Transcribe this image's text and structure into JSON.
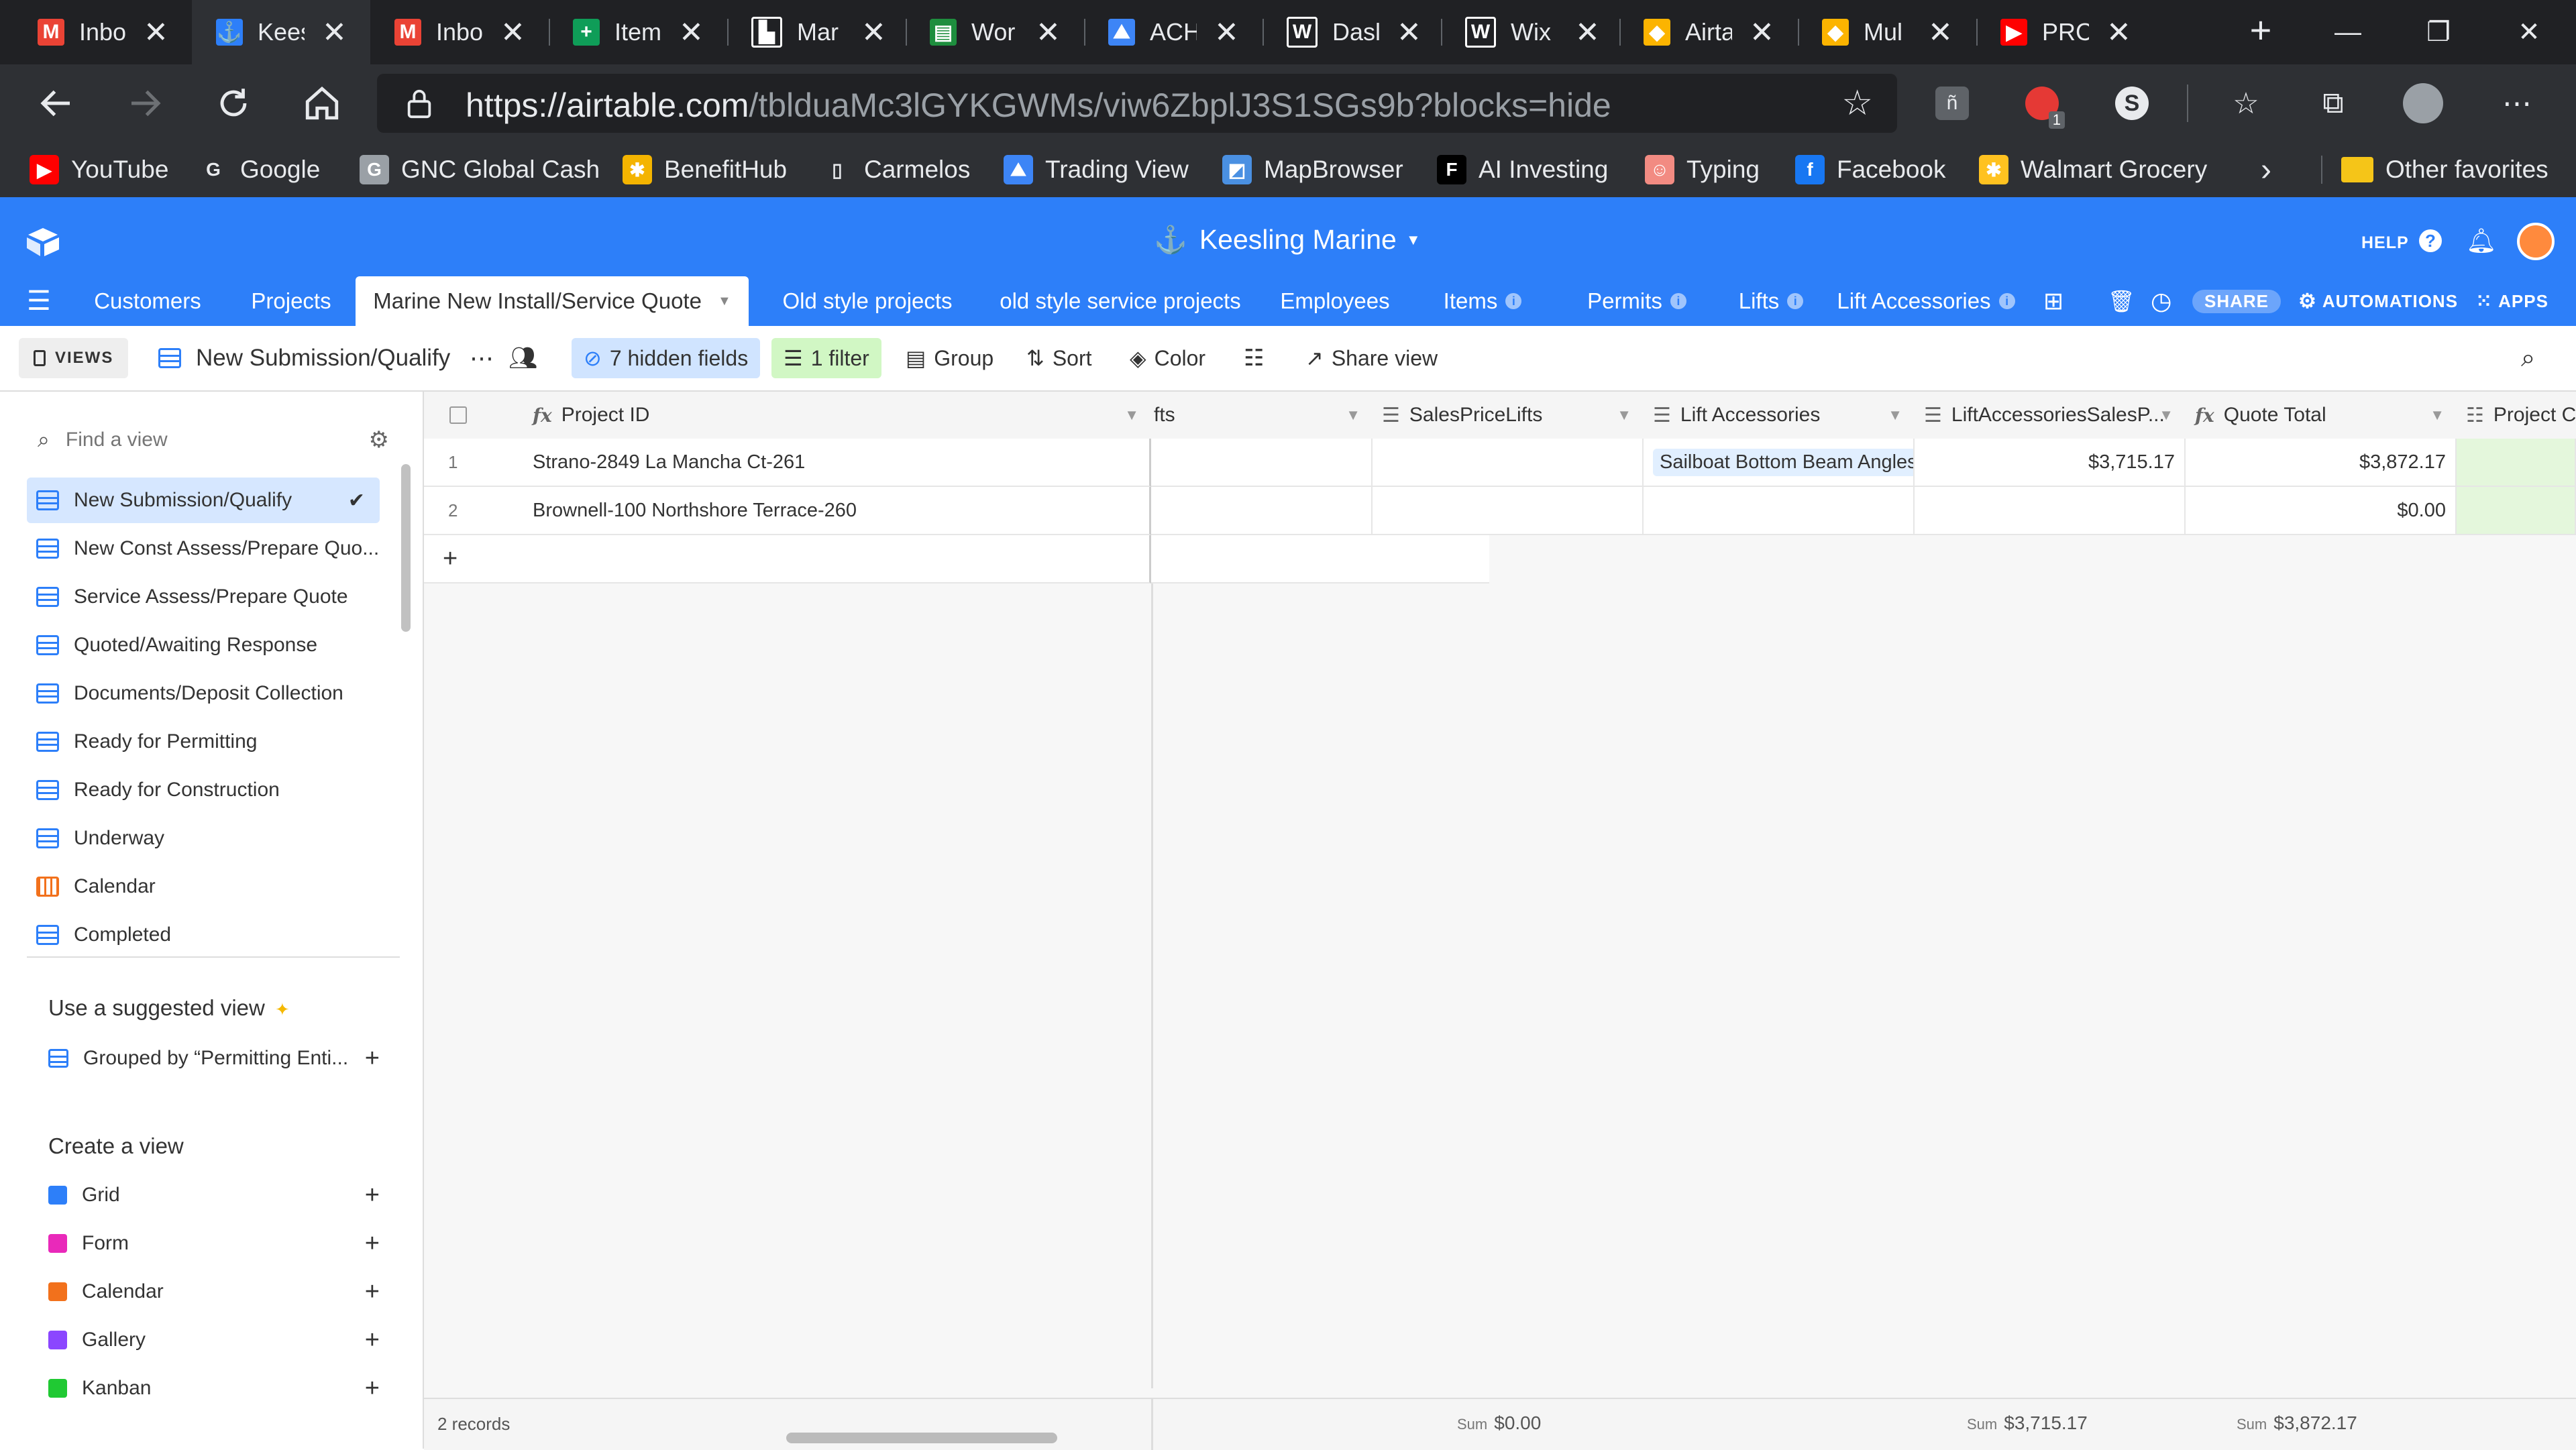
{
  "browser": {
    "tabs": [
      {
        "title": "Inbo",
        "icon": "gmail-icon",
        "color": "#ea4335",
        "glyph": "M"
      },
      {
        "title": "Kees",
        "icon": "anchor-icon",
        "color": "#2d7ff9",
        "glyph": "⚓",
        "active": true
      },
      {
        "title": "Inbo",
        "icon": "gmail-icon",
        "color": "#ea4335",
        "glyph": "M"
      },
      {
        "title": "Item",
        "icon": "sheets-icon",
        "color": "#0f9d58",
        "glyph": "+"
      },
      {
        "title": "Mar",
        "icon": "document-icon",
        "color": "#ffffff",
        "glyph": "▙"
      },
      {
        "title": "Wor",
        "icon": "spreadsheet-icon",
        "color": "#1e8e3e",
        "glyph": "▤"
      },
      {
        "title": "ACH",
        "icon": "tradingview-icon",
        "color": "#3d85f6",
        "glyph": "⛰"
      },
      {
        "title": "Dasl",
        "icon": "wix-icon",
        "color": "#ffffff",
        "glyph": "W"
      },
      {
        "title": "Wix",
        "icon": "wix-icon",
        "color": "#ffffff",
        "glyph": "W"
      },
      {
        "title": "Airta",
        "icon": "airtable-icon",
        "color": "#fcb400",
        "glyph": "◆"
      },
      {
        "title": "Mul",
        "icon": "airtable-icon",
        "color": "#fcb400",
        "glyph": "◆"
      },
      {
        "title": "PRC",
        "icon": "youtube-icon",
        "color": "#ff0000",
        "glyph": "▶"
      }
    ],
    "close_glyph": "✕",
    "new_tab_glyph": "+",
    "window_controls": {
      "minimize": "—",
      "restore": "❐",
      "close": "✕"
    },
    "url": {
      "host": "https://airtable.com",
      "path": "/tblduaMc3lGYKGWMs/viw6ZbplJ3S1SGs9b?blocks=hide"
    },
    "extension_badge": "1",
    "bookmarks": [
      {
        "label": "YouTube",
        "icon": "youtube-icon",
        "color": "#ff0000",
        "glyph": "▶"
      },
      {
        "label": "Google",
        "icon": "google-icon",
        "color": "#ffffff",
        "glyph": "G"
      },
      {
        "label": "GNC Global Cash",
        "icon": "gnc-icon",
        "color": "#9aa0a6",
        "glyph": "G"
      },
      {
        "label": "BenefitHub",
        "icon": "benefithub-icon",
        "color": "#f4b400",
        "glyph": "✱"
      },
      {
        "label": "Carmelos",
        "icon": "page-icon",
        "color": "#e8eaed",
        "glyph": "▯"
      },
      {
        "label": "Trading View",
        "icon": "tradingview-icon",
        "color": "#3d85f6",
        "glyph": "⛰"
      },
      {
        "label": "MapBrowser",
        "icon": "map-icon",
        "color": "#4a90e2",
        "glyph": "◩"
      },
      {
        "label": "AI Investing",
        "icon": "f-icon",
        "color": "#000000",
        "glyph": "F"
      },
      {
        "label": "Typing",
        "icon": "typing-icon",
        "color": "#f28b82",
        "glyph": "☺"
      },
      {
        "label": "Facebook",
        "icon": "facebook-icon",
        "color": "#1877f2",
        "glyph": "f"
      },
      {
        "label": "Walmart Grocery",
        "icon": "walmart-icon",
        "color": "#ffc220",
        "glyph": "✱"
      }
    ],
    "more_bookmarks_glyph": "›",
    "other_favorites": "Other favorites"
  },
  "airtable": {
    "base_name": "Keesling Marine",
    "help_label": "HELP",
    "tables": [
      {
        "label": "Customers"
      },
      {
        "label": "Projects"
      },
      {
        "label": "Marine New Install/Service Quote",
        "active": true
      },
      {
        "label": "Old style projects"
      },
      {
        "label": "old style service projects"
      },
      {
        "label": "Employees"
      },
      {
        "label": "Items",
        "info": true
      },
      {
        "label": "Permits",
        "info": true
      },
      {
        "label": "Lifts",
        "info": true
      },
      {
        "label": "Lift Accessories",
        "info": true
      }
    ],
    "share_label": "SHARE",
    "automations_label": "AUTOMATIONS",
    "apps_label": "APPS",
    "viewbar": {
      "views_label": "VIEWS",
      "current_view": "New Submission/Qualify",
      "hidden_fields": "7 hidden fields",
      "filter": "1 filter",
      "group": "Group",
      "sort": "Sort",
      "color": "Color",
      "share_view": "Share view"
    },
    "sidebar": {
      "find_placeholder": "Find a view",
      "views": [
        {
          "label": "New Submission/Qualify",
          "type": "grid",
          "selected": true
        },
        {
          "label": "New Const Assess/Prepare Quo...",
          "type": "grid"
        },
        {
          "label": "Service Assess/Prepare Quote",
          "type": "grid"
        },
        {
          "label": "Quoted/Awaiting Response",
          "type": "grid"
        },
        {
          "label": "Documents/Deposit Collection",
          "type": "grid"
        },
        {
          "label": "Ready for Permitting",
          "type": "grid"
        },
        {
          "label": "Ready for Construction",
          "type": "grid"
        },
        {
          "label": "Underway",
          "type": "grid"
        },
        {
          "label": "Calendar",
          "type": "calendar"
        },
        {
          "label": "Completed",
          "type": "grid"
        }
      ],
      "suggested_heading": "Use a suggested view",
      "suggested_item": "Grouped by “Permitting Enti...",
      "create_heading": "Create a view",
      "create_items": [
        {
          "label": "Grid",
          "color": "#2d7ff9"
        },
        {
          "label": "Form",
          "color": "#e929ba"
        },
        {
          "label": "Calendar",
          "color": "#f2711c"
        },
        {
          "label": "Gallery",
          "color": "#8b46ff"
        },
        {
          "label": "Kanban",
          "color": "#20c933"
        }
      ]
    },
    "grid": {
      "primary_header": "Project ID",
      "columns": [
        {
          "label": "fts"
        },
        {
          "label": "SalesPriceLifts"
        },
        {
          "label": "Lift Accessories"
        },
        {
          "label": "LiftAccessoriesSalesP..."
        },
        {
          "label": "Quote Total"
        },
        {
          "label": "Project Contract Sta"
        }
      ],
      "rows": [
        {
          "num": "1",
          "project_id": "Strano-2849 La Mancha Ct-261",
          "lift_accessory": "Sailboat Bottom Beam Angles",
          "lift_acc_sales": "$3,715.17",
          "quote_total": "$3,872.17"
        },
        {
          "num": "2",
          "project_id": "Brownell-100 Northshore Terrace-260",
          "lift_accessory": "",
          "lift_acc_sales": "",
          "quote_total": "$0.00"
        }
      ],
      "add_glyph": "+",
      "footer": {
        "records": "2 records",
        "sum_label": "Sum",
        "sum_salesprice": "$0.00",
        "sum_liftacc": "$3,715.17",
        "sum_quote": "$3,872.17"
      }
    }
  }
}
